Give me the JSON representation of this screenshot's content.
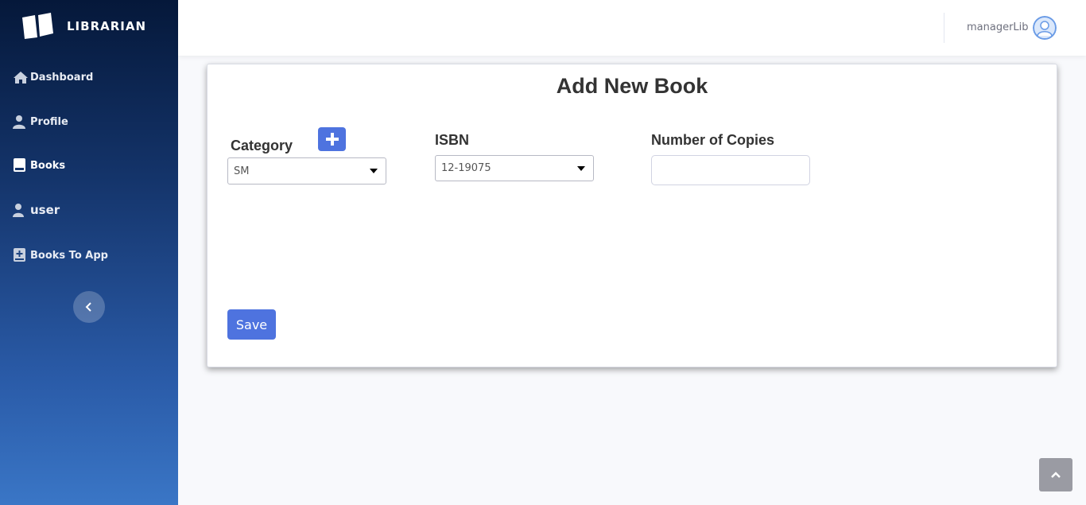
{
  "brand": {
    "name": "LIBRARIAN",
    "icon": "open-book-icon"
  },
  "sidebar": {
    "items": [
      {
        "label": "Dashboard",
        "icon": "home-icon"
      },
      {
        "label": "Profile",
        "icon": "user-icon"
      },
      {
        "label": "Books",
        "icon": "book-icon",
        "active": true
      },
      {
        "label": "user",
        "icon": "user-icon"
      },
      {
        "label": "Books To App",
        "icon": "book-plus-icon"
      }
    ],
    "collapse_icon": "chevron-left-icon"
  },
  "topbar": {
    "username": "managerLib",
    "avatar_icon": "user-avatar-icon"
  },
  "form": {
    "title": "Add New Book",
    "category": {
      "label": "Category",
      "value": "SM",
      "add_icon": "plus-icon"
    },
    "isbn": {
      "label": "ISBN",
      "value": "12-19075"
    },
    "copies": {
      "label": "Number of Copies",
      "value": ""
    },
    "save_label": "Save"
  },
  "scroll_top_icon": "chevron-up-icon",
  "colors": {
    "primary": "#4e73df",
    "sidebar_top": "#05183a",
    "sidebar_bottom": "#3a76c6"
  }
}
